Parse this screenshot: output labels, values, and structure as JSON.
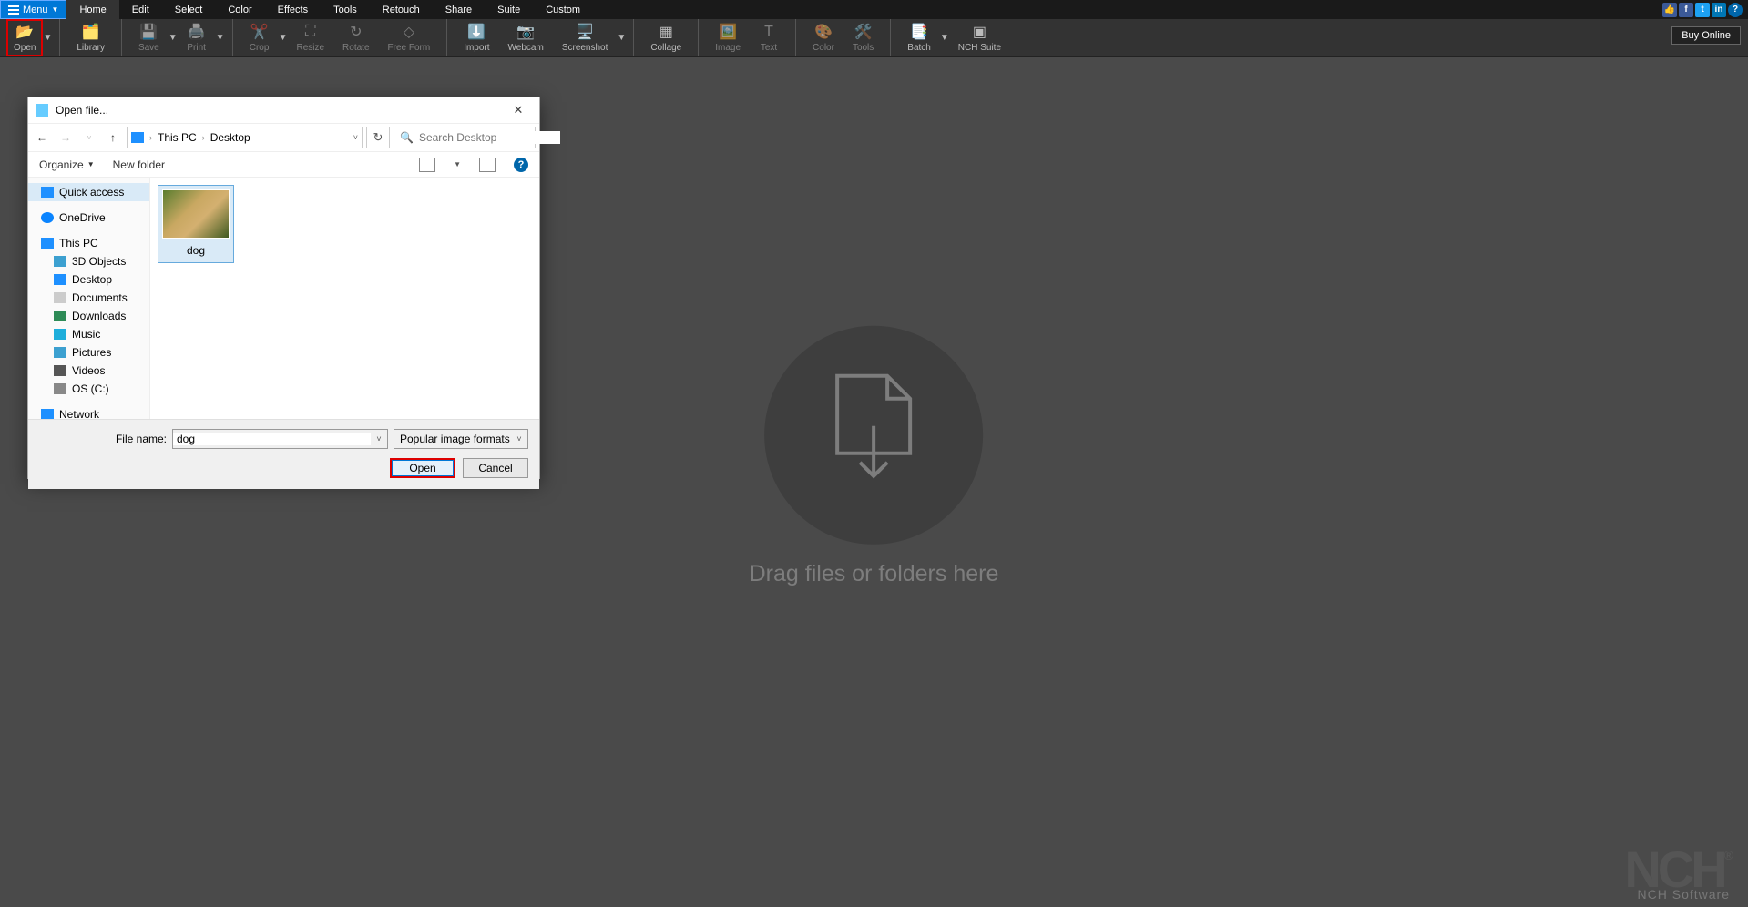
{
  "menubar": {
    "menu_label": "Menu",
    "tabs": [
      "Home",
      "Edit",
      "Select",
      "Color",
      "Effects",
      "Tools",
      "Retouch",
      "Share",
      "Suite",
      "Custom"
    ]
  },
  "ribbon": {
    "open": "Open",
    "library": "Library",
    "save": "Save",
    "print": "Print",
    "crop": "Crop",
    "resize": "Resize",
    "rotate": "Rotate",
    "freeform": "Free Form",
    "import": "Import",
    "webcam": "Webcam",
    "screenshot": "Screenshot",
    "collage": "Collage",
    "image": "Image",
    "text": "Text",
    "color": "Color",
    "tools": "Tools",
    "batch": "Batch",
    "nchsuite": "NCH Suite",
    "buy": "Buy Online"
  },
  "dropzone_text": "Drag files or folders here",
  "watermark": {
    "logo": "NCH",
    "sub": "NCH Software"
  },
  "dialog": {
    "title": "Open file...",
    "breadcrumb": [
      "This PC",
      "Desktop"
    ],
    "search_placeholder": "Search Desktop",
    "organize": "Organize",
    "newfolder": "New folder",
    "tree": {
      "quick": "Quick access",
      "onedrive": "OneDrive",
      "thispc": "This PC",
      "objects3d": "3D Objects",
      "desktop": "Desktop",
      "documents": "Documents",
      "downloads": "Downloads",
      "music": "Music",
      "pictures": "Pictures",
      "videos": "Videos",
      "osc": "OS (C:)",
      "network": "Network"
    },
    "file_item": "dog",
    "filename_label": "File name:",
    "filename_value": "dog",
    "filter": "Popular image formats",
    "open_btn": "Open",
    "cancel_btn": "Cancel"
  }
}
